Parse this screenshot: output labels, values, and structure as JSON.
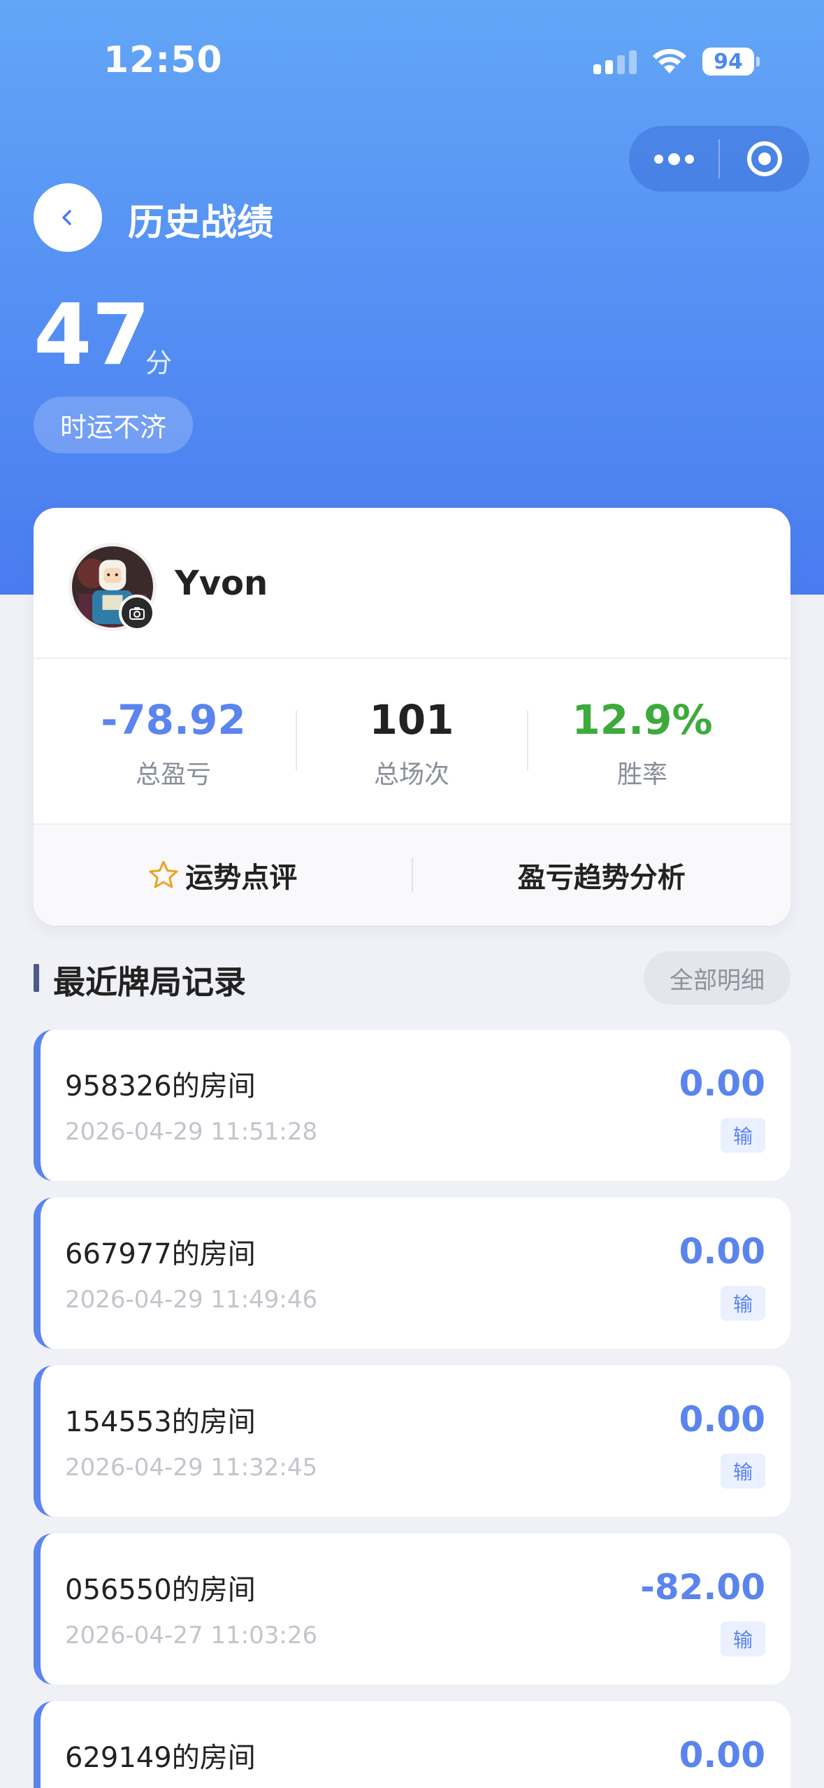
{
  "status_bar": {
    "time": "12:50",
    "battery": "94"
  },
  "nav": {
    "title": "历史战绩"
  },
  "score": {
    "value": "47",
    "unit": "分",
    "badge": "时运不济"
  },
  "profile": {
    "username": "Yvon"
  },
  "stats": [
    {
      "value": "-78.92",
      "label": "总盈亏",
      "color": "#5a84ee"
    },
    {
      "value": "101",
      "label": "总场次",
      "color": "#222222"
    },
    {
      "value": "12.9%",
      "label": "胜率",
      "color": "#3daa3c"
    }
  ],
  "actions": {
    "fortune_label": "运势点评",
    "trend_label": "盈亏趋势分析"
  },
  "section": {
    "title": "最近牌局记录",
    "all_label": "全部明细"
  },
  "records": [
    {
      "room": "958326的房间",
      "time": "2026-04-29 11:51:28",
      "amount": "0.00",
      "result": "输"
    },
    {
      "room": "667977的房间",
      "time": "2026-04-29 11:49:46",
      "amount": "0.00",
      "result": "输"
    },
    {
      "room": "154553的房间",
      "time": "2026-04-29 11:32:45",
      "amount": "0.00",
      "result": "输"
    },
    {
      "room": "056550的房间",
      "time": "2026-04-27 11:03:26",
      "amount": "-82.00",
      "result": "输"
    },
    {
      "room": "629149的房间",
      "time": "",
      "amount": "0.00",
      "result": ""
    }
  ],
  "colors": {
    "accent": "#5a84ee",
    "win": "#3daa3c",
    "star": "#f0a020"
  }
}
